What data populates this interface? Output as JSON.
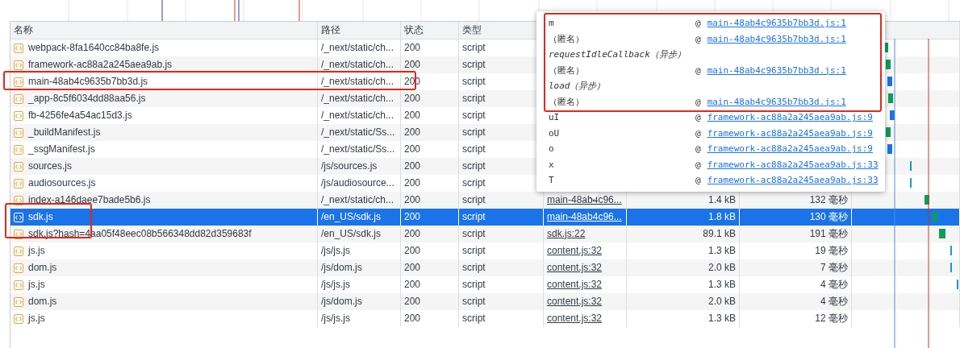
{
  "columns": [
    "名称",
    "路径",
    "状态",
    "类型"
  ],
  "rows": [
    {
      "name": "webpack-8fa1640cc84ba8fe.js",
      "path": "/_next/static/ch...",
      "status": "200",
      "type": "script",
      "selected": false
    },
    {
      "name": "framework-ac88a2a245aea9ab.js",
      "path": "/_next/static/ch...",
      "status": "200",
      "type": "script",
      "selected": false
    },
    {
      "name": "main-48ab4c9635b7bb3d.js",
      "path": "/_next/static/ch...",
      "status": "200",
      "type": "script",
      "selected": false,
      "annotated": true,
      "annotation_wide": true
    },
    {
      "name": "_app-8c5f6034dd88aa56.js",
      "path": "/_next/static/ch...",
      "status": "200",
      "type": "script",
      "selected": false
    },
    {
      "name": "fb-4256fe4a54ac15d3.js",
      "path": "/_next/static/ch...",
      "status": "200",
      "type": "script",
      "selected": false
    },
    {
      "name": "_buildManifest.js",
      "path": "/_next/static/Ss...",
      "status": "200",
      "type": "script",
      "selected": false
    },
    {
      "name": "_ssgManifest.js",
      "path": "/_next/static/Ss...",
      "status": "200",
      "type": "script",
      "selected": false
    },
    {
      "name": "sources.js",
      "path": "/js/sources.js",
      "status": "200",
      "type": "script",
      "selected": false
    },
    {
      "name": "audiosources.js",
      "path": "/js/audiosource...",
      "status": "200",
      "type": "script",
      "selected": false
    },
    {
      "name": "index-a146daee7bade5b6.js",
      "path": "/_next/static/ch...",
      "status": "200",
      "type": "script",
      "selected": false,
      "initiator": "main-48ab4c96...",
      "size": "1.4 kB",
      "time": "132 毫秒"
    },
    {
      "name": "sdk.js",
      "path": "/en_US/sdk.js",
      "status": "200",
      "type": "script",
      "selected": true,
      "annotated": true,
      "annotation_wide": false,
      "initiator": "main-48ab4c96...",
      "size": "1.8 kB",
      "time": "130 毫秒"
    },
    {
      "name": "sdk.js?hash=4aa05f48eec08b566348dd82d359683f",
      "path": "/en_US/sdk.js",
      "status": "200",
      "type": "script",
      "selected": false,
      "initiator": "sdk.js:22",
      "size": "89.1 kB",
      "time": "191 毫秒"
    },
    {
      "name": "js.js",
      "path": "/js/js.js",
      "status": "200",
      "type": "script",
      "selected": false,
      "initiator": "content.js:32",
      "size": "1.3 kB",
      "time": "19 毫秒"
    },
    {
      "name": "dom.js",
      "path": "/js/dom.js",
      "status": "200",
      "type": "script",
      "selected": false,
      "initiator": "content.js:32",
      "size": "2.0 kB",
      "time": "7 毫秒"
    },
    {
      "name": "js.js",
      "path": "/js/js.js",
      "status": "200",
      "type": "script",
      "selected": false,
      "initiator": "content.js:32",
      "size": "1.3 kB",
      "time": "4 毫秒"
    },
    {
      "name": "dom.js",
      "path": "/js/dom.js",
      "status": "200",
      "type": "script",
      "selected": false,
      "initiator": "content.js:32",
      "size": "2.0 kB",
      "time": "4 毫秒"
    },
    {
      "name": "js.js",
      "path": "/js/js.js",
      "status": "200",
      "type": "script",
      "selected": false,
      "initiator": "content.js:32",
      "size": "1.3 kB",
      "time": "12 毫秒"
    }
  ],
  "tooltip": {
    "groups": [
      {
        "annotated": true,
        "entries": [
          {
            "kind": "frame",
            "name": "m",
            "at": "@",
            "link": "main-48ab4c9635b7bb3d.js:1"
          },
          {
            "kind": "frame",
            "name": "（匿名）",
            "at": "@",
            "link": "main-48ab4c9635b7bb3d.js:1"
          },
          {
            "kind": "async",
            "name": "requestIdleCallback（异步）"
          },
          {
            "kind": "frame",
            "name": "（匿名）",
            "at": "@",
            "link": "main-48ab4c9635b7bb3d.js:1"
          },
          {
            "kind": "async",
            "name": "load（异步）"
          },
          {
            "kind": "frame",
            "name": "（匿名）",
            "at": "@",
            "link": "main-48ab4c9635b7bb3d.js:1"
          }
        ]
      },
      {
        "annotated": false,
        "entries": [
          {
            "kind": "frame",
            "name": "uI",
            "at": "@",
            "link": "framework-ac88a2a245aea9ab.js:9"
          },
          {
            "kind": "frame",
            "name": "oU",
            "at": "@",
            "link": "framework-ac88a2a245aea9ab.js:9"
          },
          {
            "kind": "frame",
            "name": "o",
            "at": "@",
            "link": "framework-ac88a2a245aea9ab.js:9"
          },
          {
            "kind": "frame",
            "name": "x",
            "at": "@",
            "link": "framework-ac88a2a245aea9ab.js:33"
          },
          {
            "kind": "frame",
            "name": "T",
            "at": "@",
            "link": "framework-ac88a2a245aea9ab.js:33"
          }
        ]
      }
    ]
  }
}
